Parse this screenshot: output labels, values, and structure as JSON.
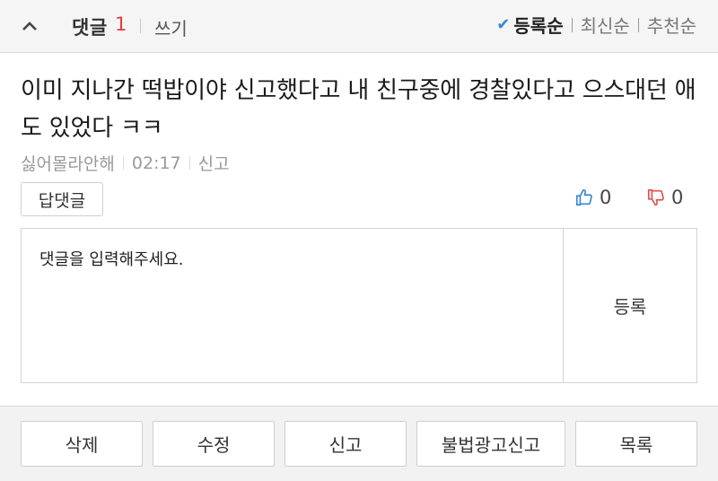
{
  "header": {
    "collapse_icon": "chevron-up-icon",
    "title": "댓글",
    "count": "1",
    "write_label": "쓰기",
    "sort": {
      "check_icon": "checkmark-icon",
      "active": "등록순",
      "latest": "최신순",
      "recommended": "추천순"
    }
  },
  "comment": {
    "text": "이미 지나간 떡밥이야 신고했다고 내 친구중에 경찰있다고 으스대던 애도 있었다 ㅋㅋ",
    "author": "싫어몰라안해",
    "time": "02:17",
    "report_label": "신고",
    "reply_label": "답댓글",
    "likes": "0",
    "dislikes": "0",
    "like_icon": "thumbs-up-icon",
    "dislike_icon": "thumbs-down-icon"
  },
  "reply_form": {
    "placeholder": "댓글을 입력해주세요.",
    "submit_label": "등록"
  },
  "footer": {
    "delete_label": "삭제",
    "edit_label": "수정",
    "report_label": "신고",
    "illegal_ad_label": "불법광고신고",
    "list_label": "목록"
  },
  "colors": {
    "count": "#e63c3c",
    "check": "#3a86d6",
    "like": "#3a86d6",
    "dislike": "#e05050"
  }
}
